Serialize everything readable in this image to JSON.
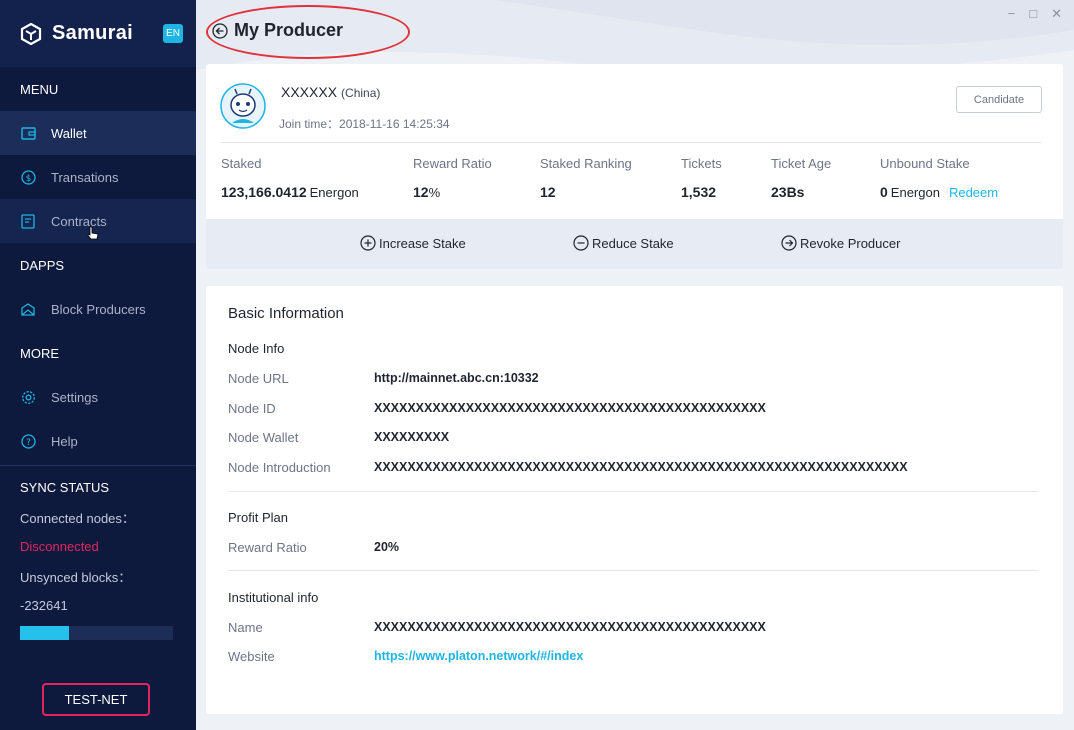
{
  "app": {
    "name": "Samurai",
    "lang_badge": "EN"
  },
  "window": {
    "minimize": "−",
    "maximize": "□",
    "close": "✕"
  },
  "sidebar": {
    "menu_title": "MENU",
    "items": [
      {
        "label": "Wallet",
        "icon": "wallet-icon",
        "active": true
      },
      {
        "label": "Transations",
        "icon": "dollar-icon",
        "active": false
      },
      {
        "label": "Contracts",
        "icon": "contract-icon",
        "active": false
      }
    ],
    "dapps_title": "DAPPS",
    "dapps_items": [
      {
        "label": "Block Producers",
        "icon": "block-producers-icon"
      }
    ],
    "more_title": "MORE",
    "more_items": [
      {
        "label": "Settings",
        "icon": "gear-icon"
      },
      {
        "label": "Help",
        "icon": "help-icon"
      }
    ],
    "sync": {
      "title": "SYNC STATUS",
      "connected_label": "Connected nodes：",
      "connected_value": "Disconnected",
      "unsynced_label": "Unsynced blocks：",
      "unsynced_value": "-232641",
      "progress_fraction": 0.32
    },
    "network_button": "TEST-NET"
  },
  "page": {
    "title": "My Producer"
  },
  "producer": {
    "name": "XXXXXX",
    "country": "(China)",
    "join_time": "Join time：2018-11-16 14:25:34",
    "status_button": "Candidate",
    "stats": [
      {
        "label": "Staked",
        "value": "123,166.0412",
        "unit": "Energon"
      },
      {
        "label": "Reward Ratio",
        "value": "12",
        "unit": "%"
      },
      {
        "label": "Staked Ranking",
        "value": "12",
        "unit": ""
      },
      {
        "label": "Tickets",
        "value": "1,532",
        "unit": ""
      },
      {
        "label": "Ticket Age",
        "value": "23Bs",
        "unit": ""
      },
      {
        "label": "Unbound Stake",
        "value": "0",
        "unit": "Energon",
        "link": "Redeem"
      }
    ],
    "actions": {
      "increase": "Increase Stake",
      "reduce": "Reduce Stake",
      "revoke": "Revoke Producer"
    }
  },
  "basic_info": {
    "title": "Basic Information",
    "node_info": {
      "title": "Node Info",
      "rows": [
        {
          "key": "Node URL",
          "value": "http://mainnet.abc.cn:10332"
        },
        {
          "key": "Node ID",
          "value": "XXXXXXXXXXXXXXXXXXXXXXXXXXXXXXXXXXXXXXXXXXXXXXX"
        },
        {
          "key": "Node Wallet",
          "value": "XXXXXXXXX"
        },
        {
          "key": "Node Introduction",
          "value": "XXXXXXXXXXXXXXXXXXXXXXXXXXXXXXXXXXXXXXXXXXXXXXXXXXXXXXXXXXXXXXXX"
        }
      ]
    },
    "profit_plan": {
      "title": "Profit Plan",
      "rows": [
        {
          "key": "Reward Ratio",
          "value": "20%"
        }
      ]
    },
    "institutional": {
      "title": "Institutional info",
      "rows": [
        {
          "key": "Name",
          "value": "XXXXXXXXXXXXXXXXXXXXXXXXXXXXXXXXXXXXXXXXXXXXXXX"
        },
        {
          "key": "Website",
          "value": "https://www.platon.network/#/index"
        }
      ]
    }
  },
  "colors": {
    "sidebar_bg": "#0e1a3d",
    "accent": "#1fb5e3",
    "danger": "#e0265d"
  }
}
